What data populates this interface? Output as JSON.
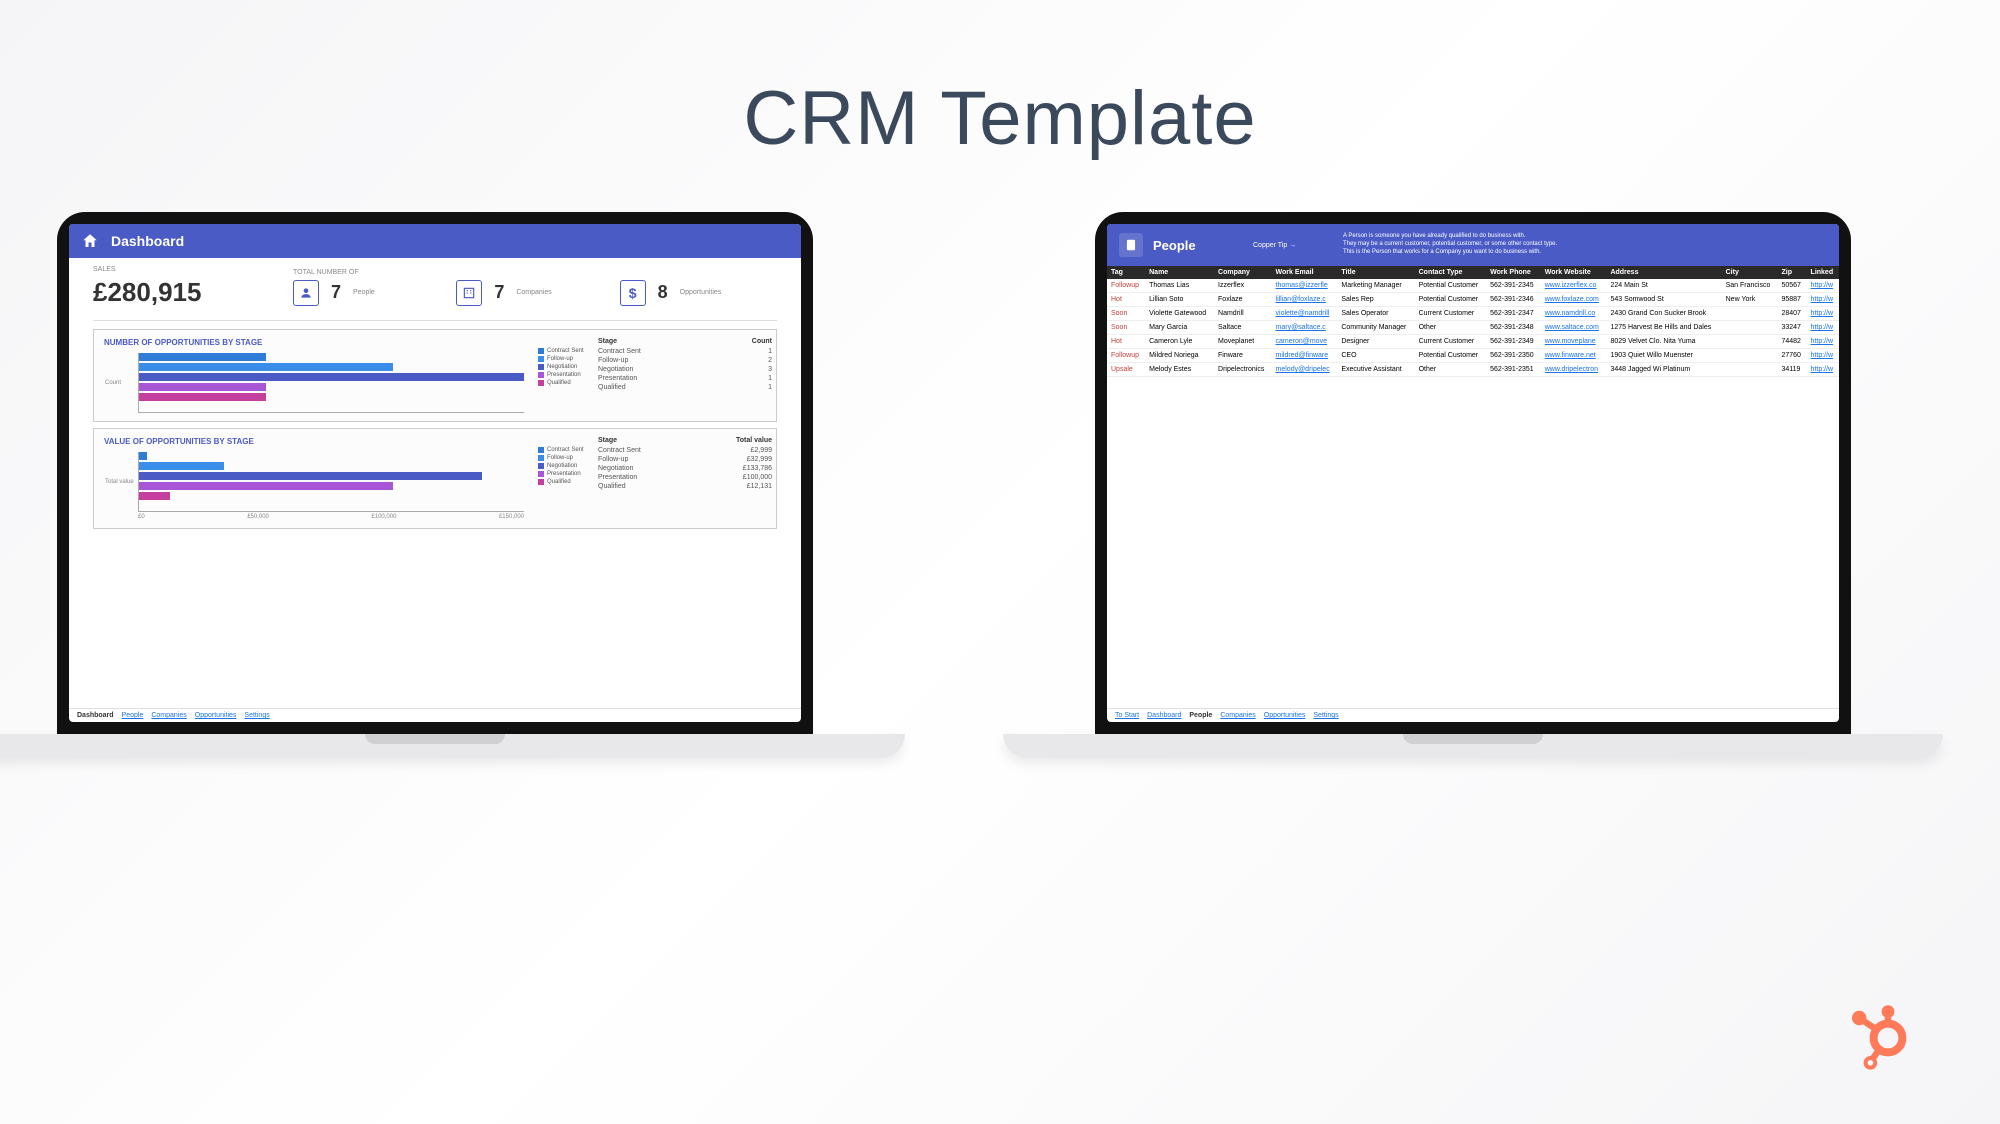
{
  "page_title": "CRM  Template",
  "dashboard": {
    "header_title": "Dashboard",
    "sales_label": "SALES",
    "sales_value": "£280,915",
    "total_label": "TOTAL NUMBER OF",
    "metrics": [
      {
        "value": "7",
        "label": "People"
      },
      {
        "value": "7",
        "label": "Companies"
      },
      {
        "value": "8",
        "label": "Opportunities"
      }
    ],
    "chart1_title": "NUMBER OF OPPORTUNITIES BY STAGE",
    "chart1_ylabel": "Count",
    "stage_table1": {
      "h1": "Stage",
      "h2": "Count",
      "rows": [
        {
          "stage": "Contract Sent",
          "val": "1"
        },
        {
          "stage": "Follow-up",
          "val": "2"
        },
        {
          "stage": "Negotiation",
          "val": "3"
        },
        {
          "stage": "Presentation",
          "val": "1"
        },
        {
          "stage": "Qualified",
          "val": "1"
        }
      ]
    },
    "chart2_title": "VALUE OF OPPORTUNITIES BY STAGE",
    "chart2_ylabel": "Total value",
    "chart2_xlabels": [
      "£0",
      "£50,000",
      "£100,000",
      "£150,000"
    ],
    "stage_table2": {
      "h1": "Stage",
      "h2": "Total value",
      "rows": [
        {
          "stage": "Contract Sent",
          "val": "£2,999"
        },
        {
          "stage": "Follow-up",
          "val": "£32,999"
        },
        {
          "stage": "Negotiation",
          "val": "£133,786"
        },
        {
          "stage": "Presentation",
          "val": "£100,000"
        },
        {
          "stage": "Qualified",
          "val": "£12,131"
        }
      ]
    },
    "legend": [
      "Contract Sent",
      "Follow-up",
      "Negotiation",
      "Presentation",
      "Qualified"
    ],
    "tabs": [
      "Dashboard",
      "People",
      "Companies",
      "Opportunities",
      "Settings"
    ]
  },
  "people": {
    "header_title": "People",
    "tip_label": "Copper Tip →",
    "desc_line1": "A Person is someone you have already qualified to do business with.",
    "desc_line2": "They may be a current customer, potential customer, or some other contact type.",
    "desc_line3": "This is the Person that works for a Company you want to do business with.",
    "columns": [
      "Tag",
      "Name",
      "Company",
      "Work Email",
      "Title",
      "Contact Type",
      "Work Phone",
      "Work Website",
      "Address",
      "City",
      "Zip",
      "Linked"
    ],
    "rows": [
      {
        "tag": "Followup",
        "name": "Thomas Lias",
        "company": "Izzerflex",
        "email": "thomas@izzerfle",
        "title": "Marketing Manager",
        "ctype": "Potential Customer",
        "phone": "562-391-2345",
        "web": "www.izzerflex.co",
        "addr": "224 Main St",
        "city": "San Francisco",
        "zip": "50567",
        "link": "http://w"
      },
      {
        "tag": "Hot",
        "name": "Lillian Soto",
        "company": "Foxlaze",
        "email": "lillian@foxlaze.c",
        "title": "Sales Rep",
        "ctype": "Potential Customer",
        "phone": "562-391-2346",
        "web": "www.foxlaze.com",
        "addr": "543 Somwood St",
        "city": "New York",
        "zip": "95887",
        "link": "http://w"
      },
      {
        "tag": "Soon",
        "name": "Violette Gatewood",
        "company": "Namdrill",
        "email": "violette@namdrill",
        "title": "Sales Operator",
        "ctype": "Current Customer",
        "phone": "562-391-2347",
        "web": "www.namdrill.co",
        "addr": "2430 Grand Con Sucker Brook",
        "city": "",
        "zip": "28407",
        "link": "http://w"
      },
      {
        "tag": "Soon",
        "name": "Mary Garcia",
        "company": "Saltace",
        "email": "mary@saltace.c",
        "title": "Community Manager",
        "ctype": "Other",
        "phone": "562-391-2348",
        "web": "www.saltace.com",
        "addr": "1275 Harvest Be Hills and Dales",
        "city": "",
        "zip": "33247",
        "link": "http://w"
      },
      {
        "tag": "Hot",
        "name": "Cameron Lyle",
        "company": "Moveplanet",
        "email": "cameron@move",
        "title": "Designer",
        "ctype": "Current Customer",
        "phone": "562-391-2349",
        "web": "www.moveplane",
        "addr": "8029 Velvet Clo. Nita Yuma",
        "city": "",
        "zip": "74482",
        "link": "http://w"
      },
      {
        "tag": "Followup",
        "name": "Mildred Noriega",
        "company": "Finware",
        "email": "mildred@finware",
        "title": "CEO",
        "ctype": "Potential Customer",
        "phone": "562-391-2350",
        "web": "www.finware.net",
        "addr": "1903 Quiet Willo Muenster",
        "city": "",
        "zip": "27760",
        "link": "http://w"
      },
      {
        "tag": "Upsale",
        "name": "Melody Estes",
        "company": "Dripelectronics",
        "email": "melody@dripelec",
        "title": "Executive Assistant",
        "ctype": "Other",
        "phone": "562-391-2351",
        "web": "www.dripelectron",
        "addr": "3448 Jagged Wi Platinum",
        "city": "",
        "zip": "34119",
        "link": "http://w"
      }
    ],
    "tabs": [
      "To Start",
      "Dashboard",
      "People",
      "Companies",
      "Opportunities",
      "Settings"
    ]
  },
  "chart_data": [
    {
      "type": "bar",
      "orientation": "horizontal",
      "title": "NUMBER OF OPPORTUNITIES BY STAGE",
      "ylabel": "Count",
      "categories": [
        "Contract Sent",
        "Follow-up",
        "Negotiation",
        "Presentation",
        "Qualified"
      ],
      "values": [
        1,
        2,
        3,
        1,
        1
      ],
      "xlim": [
        0,
        3
      ]
    },
    {
      "type": "bar",
      "orientation": "horizontal",
      "title": "VALUE OF OPPORTUNITIES BY STAGE",
      "ylabel": "Total value",
      "categories": [
        "Contract Sent",
        "Follow-up",
        "Negotiation",
        "Presentation",
        "Qualified"
      ],
      "values": [
        2999,
        32999,
        133786,
        100000,
        12131
      ],
      "xlim": [
        0,
        150000
      ],
      "xticks": [
        0,
        50000,
        100000,
        150000
      ]
    }
  ]
}
